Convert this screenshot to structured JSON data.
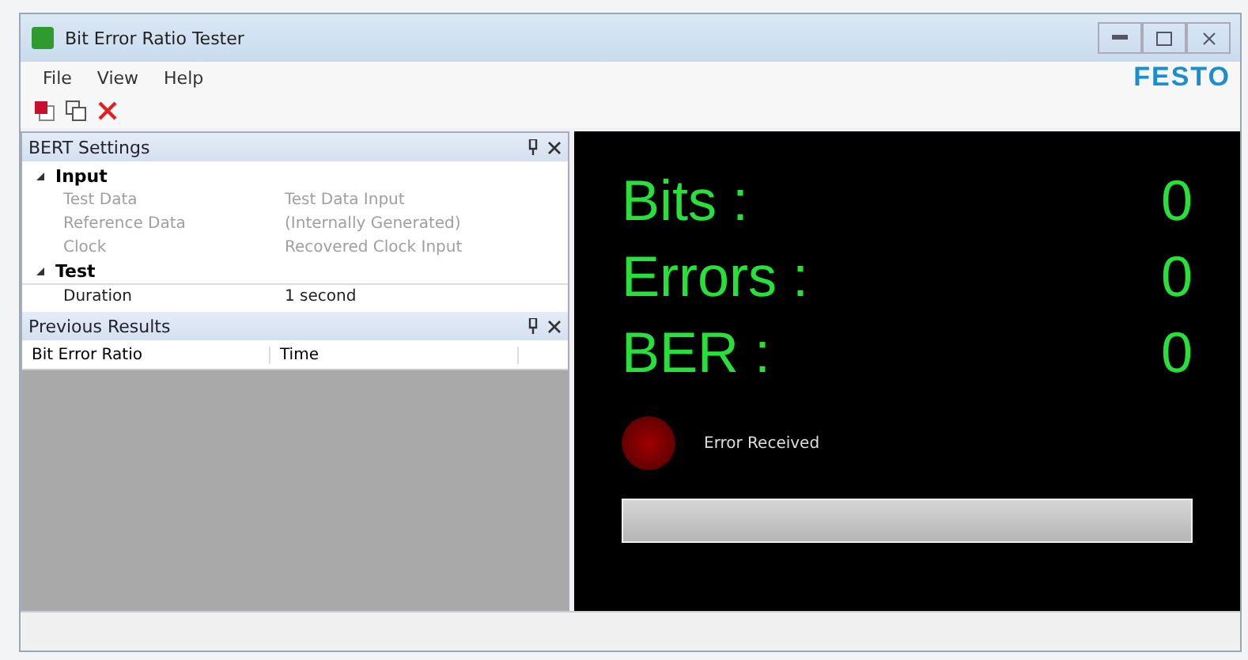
{
  "window": {
    "title": "Bit Error Ratio Tester"
  },
  "menu": [
    "File",
    "View",
    "Help"
  ],
  "logo": "FESTO",
  "settings_panel": {
    "title": "BERT Settings",
    "categories": [
      {
        "label": "Input",
        "expanded": true,
        "children": [
          {
            "name": "Test Data",
            "value": "Test Data Input",
            "disabled": true
          },
          {
            "name": "Reference Data",
            "value": "(Internally Generated)",
            "disabled": true
          },
          {
            "name": "Clock",
            "value": "Recovered Clock Input",
            "disabled": true
          }
        ]
      },
      {
        "label": "Test",
        "expanded": true,
        "children": [
          {
            "name": "Duration",
            "value": "1 second",
            "disabled": false
          }
        ]
      }
    ]
  },
  "results_panel": {
    "title": "Previous Results",
    "columns": [
      "Bit Error Ratio",
      "Time"
    ]
  },
  "readouts": [
    {
      "label": "Bits :",
      "value": "0"
    },
    {
      "label": "Errors :",
      "value": "0"
    },
    {
      "label": "BER :",
      "value": "0"
    }
  ],
  "error_indicator": {
    "label": "Error Received",
    "on": false
  },
  "progress": {
    "level": 0
  }
}
